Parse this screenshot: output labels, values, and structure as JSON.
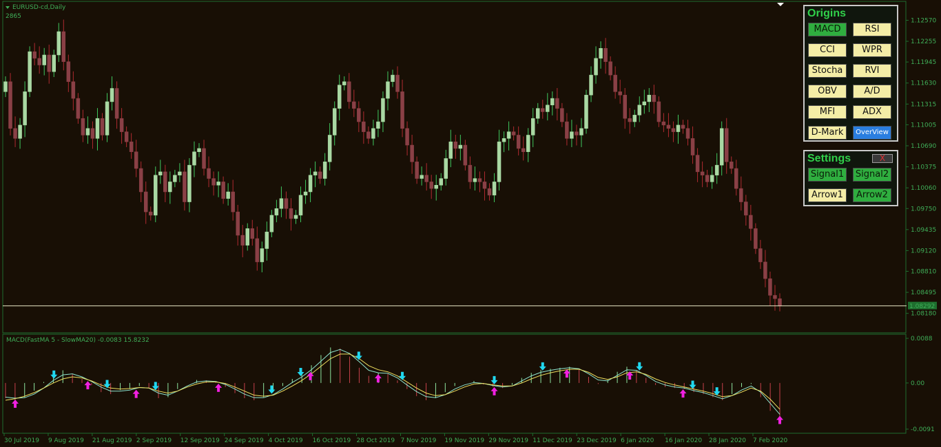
{
  "window": {
    "symbol_label": "EURUSD-cd,Daily",
    "sub_label": "2865",
    "menu_icon": "triangle-down-icon",
    "shift_marker_icon": "triangle-down-icon"
  },
  "colors": {
    "background": "#180f05",
    "grid_border": "#1e6e2e",
    "axis_text": "#3fae58",
    "bull_candle": "#a9d8a3",
    "bull_wick": "#3fc95f",
    "bear_candle": "#8a4046",
    "bear_wick": "#b02a30",
    "price_line": "#ecebc8",
    "macd_up_hist": "#8fe6a0",
    "macd_down_hist": "#c8414b",
    "signal_fast": "#8fe6d0",
    "signal_slow": "#f0e060",
    "arrow_down": "#20d8f0",
    "arrow_up": "#f020e0",
    "button_active": "#2fae3f",
    "button_inactive": "#f4eda6",
    "button_overview": "#2a7ee0"
  },
  "chart_data": [
    {
      "type": "candlestick",
      "symbol": "EURUSD-cd",
      "timeframe": "Daily",
      "ylim": [
        1.0795,
        1.1275
      ],
      "y_ticks": [
        "1.12570",
        "1.12255",
        "1.11945",
        "1.11630",
        "1.11315",
        "1.11005",
        "1.10690",
        "1.10375",
        "1.10060",
        "1.09750",
        "1.09435",
        "1.09120",
        "1.08810",
        "1.08495",
        "1.08180"
      ],
      "x_ticks": [
        "30 Jul 2019",
        "9 Aug 2019",
        "21 Aug 2019",
        "2 Sep 2019",
        "12 Sep 2019",
        "24 Sep 2019",
        "4 Oct 2019",
        "16 Oct 2019",
        "28 Oct 2019",
        "7 Nov 2019",
        "19 Nov 2019",
        "29 Nov 2019",
        "11 Dec 2019",
        "23 Dec 2019",
        "6 Jan 2020",
        "16 Jan 2020",
        "28 Jan 2020",
        "7 Feb 2020"
      ],
      "current_price": "1.08292",
      "close_values": [
        1.1165,
        1.1095,
        1.108,
        1.11,
        1.115,
        1.121,
        1.12,
        1.119,
        1.1205,
        1.118,
        1.1205,
        1.124,
        1.1195,
        1.1165,
        1.114,
        1.111,
        1.1085,
        1.1095,
        1.108,
        1.111,
        1.1085,
        1.1135,
        1.1155,
        1.111,
        1.109,
        1.1075,
        1.106,
        1.1035,
        1.1,
        1.097,
        1.0965,
        1.1025,
        1.103,
        1.1,
        1.1015,
        1.1025,
        1.103,
        1.0985,
        1.104,
        1.106,
        1.1065,
        1.1035,
        1.102,
        1.101,
        1.1015,
        1.099,
        1.1,
        1.097,
        1.0935,
        1.092,
        1.0945,
        1.093,
        1.0895,
        1.0915,
        1.094,
        1.0965,
        1.0975,
        1.099,
        1.0975,
        1.096,
        1.0965,
        1.0995,
        1.1,
        1.1025,
        1.103,
        1.102,
        1.1045,
        1.1085,
        1.1125,
        1.116,
        1.1165,
        1.1135,
        1.1125,
        1.1105,
        1.109,
        1.108,
        1.1095,
        1.1105,
        1.114,
        1.1165,
        1.1175,
        1.115,
        1.1095,
        1.107,
        1.1045,
        1.102,
        1.1025,
        1.1015,
        1.1005,
        1.101,
        1.102,
        1.105,
        1.1075,
        1.1065,
        1.107,
        1.104,
        1.1015,
        1.102,
        1.1015,
        1.1005,
        1.0995,
        1.1015,
        1.1075,
        1.108,
        1.109,
        1.1085,
        1.1065,
        1.106,
        1.1085,
        1.111,
        1.1125,
        1.112,
        1.113,
        1.114,
        1.1125,
        1.1105,
        1.108,
        1.109,
        1.1085,
        1.1095,
        1.1145,
        1.1175,
        1.12,
        1.1215,
        1.1195,
        1.1175,
        1.115,
        1.1145,
        1.111,
        1.1105,
        1.1115,
        1.113,
        1.1135,
        1.1145,
        1.1135,
        1.1105,
        1.11,
        1.1095,
        1.109,
        1.11,
        1.1095,
        1.108,
        1.1055,
        1.103,
        1.1025,
        1.1015,
        1.1025,
        1.104,
        1.1095,
        1.1045,
        1.1035,
        1.1005,
        1.0985,
        1.0965,
        1.0945,
        1.0915,
        1.0895,
        1.087,
        1.0845,
        1.084,
        1.0829
      ]
    },
    {
      "type": "bar+line",
      "title": "MACD(FastMA 5 - SlowMA20) -0.0083 15.8232",
      "ylim": [
        -0.0091,
        0.0088
      ],
      "y_ticks": [
        "0.0088",
        "0.00",
        "-0.0091"
      ],
      "series": [
        {
          "name": "",
          "values": [
            -0.003,
            -0.0034,
            -0.0028,
            -0.0015,
            0.0002,
            0.0018,
            0.0025,
            0.0018,
            0.0008,
            -0.0004,
            -0.0018,
            -0.0022,
            -0.0014,
            -0.0012,
            -0.0006,
            -0.001,
            -0.003,
            -0.0028,
            -0.0012,
            0.0,
            0.0006,
            0.0005,
            0.0002,
            -0.0008,
            -0.002,
            -0.003,
            -0.0034,
            -0.0028,
            -0.0018,
            -0.0006,
            0.0008,
            0.002,
            0.0035,
            0.0055,
            0.007,
            0.0068,
            0.0052,
            0.003,
            0.0014,
            0.002,
            0.0018,
            0.0005,
            -0.0012,
            -0.0026,
            -0.0034,
            -0.003,
            -0.0018,
            -0.0006,
            0.0,
            0.0004,
            -0.0003,
            -0.0008,
            -0.001,
            -0.0004,
            0.001,
            0.002,
            0.0026,
            0.0028,
            0.003,
            0.0032,
            0.0026,
            0.0012,
            -0.0002,
            0.0006,
            0.0022,
            0.0032,
            0.0024,
            0.001,
            -0.0004,
            -0.0008,
            -0.001,
            -0.0012,
            -0.0018,
            -0.0022,
            -0.0028,
            -0.0034,
            -0.0022,
            -0.0008,
            -0.0002,
            -0.0028,
            -0.0055,
            -0.0075
          ]
        },
        {
          "name": "",
          "values": [
            -0.0028,
            -0.003,
            -0.0029,
            -0.0022,
            -0.001,
            0.0005,
            0.0016,
            0.0018,
            0.0012,
            0.0003,
            -0.0008,
            -0.0016,
            -0.0016,
            -0.0014,
            -0.0009,
            -0.001,
            -0.002,
            -0.0024,
            -0.0016,
            -0.0006,
            0.0002,
            0.0004,
            0.0003,
            -0.0003,
            -0.0012,
            -0.0022,
            -0.0029,
            -0.0029,
            -0.0023,
            -0.0012,
            0.0001,
            0.0012,
            0.0026,
            0.0043,
            0.006,
            0.0066,
            0.0058,
            0.0042,
            0.0025,
            0.002,
            0.0019,
            0.001,
            -0.0004,
            -0.0017,
            -0.0027,
            -0.0029,
            -0.0023,
            -0.0012,
            -0.0004,
            0.0001,
            -0.0001,
            -0.0005,
            -0.0008,
            -0.0006,
            0.0004,
            0.0014,
            0.0021,
            0.0025,
            0.0028,
            0.003,
            0.0028,
            0.0018,
            0.0006,
            0.0004,
            0.0015,
            0.0026,
            0.0025,
            0.0015,
            0.0003,
            -0.0004,
            -0.0008,
            -0.001,
            -0.0015,
            -0.0019,
            -0.0025,
            -0.0031,
            -0.0025,
            -0.0014,
            -0.0006,
            -0.0018,
            -0.004,
            -0.0062
          ]
        },
        {
          "name": "",
          "values": [
            -0.0034,
            -0.0031,
            -0.0026,
            -0.0019,
            -0.001,
            0.0,
            0.0008,
            0.0012,
            0.001,
            0.0004,
            -0.0004,
            -0.001,
            -0.0012,
            -0.0011,
            -0.0009,
            -0.001,
            -0.0016,
            -0.002,
            -0.0016,
            -0.0008,
            -0.0002,
            0.0002,
            0.0002,
            -0.0001,
            -0.0008,
            -0.0016,
            -0.0024,
            -0.0026,
            -0.0024,
            -0.0016,
            -0.0006,
            0.0005,
            0.0018,
            0.0033,
            0.0048,
            0.0057,
            0.0057,
            0.0048,
            0.0034,
            0.0026,
            0.0022,
            0.0014,
            0.0002,
            -0.001,
            -0.002,
            -0.0025,
            -0.0023,
            -0.0016,
            -0.0008,
            -0.0002,
            -0.0001,
            -0.0004,
            -0.0006,
            -0.0006,
            0.0,
            0.0008,
            0.0015,
            0.002,
            0.0024,
            0.0027,
            0.0027,
            0.0021,
            0.0011,
            0.0007,
            0.0012,
            0.002,
            0.0022,
            0.0017,
            0.0008,
            0.0001,
            -0.0004,
            -0.0008,
            -0.0012,
            -0.0016,
            -0.0021,
            -0.0027,
            -0.0025,
            -0.0018,
            -0.001,
            -0.0016,
            -0.0032,
            -0.0052
          ]
        }
      ],
      "arrows_down_at": [
        10,
        21,
        31,
        55,
        61,
        73,
        82,
        101,
        111,
        131,
        142,
        147,
        168
      ],
      "arrows_up_at": [
        2,
        17,
        27,
        44,
        63,
        77,
        101,
        116,
        129,
        140,
        160
      ]
    }
  ],
  "origins_panel": {
    "title": "Origins",
    "buttons": [
      {
        "label": "MACD",
        "active": true
      },
      {
        "label": "RSI",
        "active": false
      },
      {
        "label": "CCI",
        "active": false
      },
      {
        "label": "WPR",
        "active": false
      },
      {
        "label": "Stocha",
        "active": false
      },
      {
        "label": "RVI",
        "active": false
      },
      {
        "label": "OBV",
        "active": false
      },
      {
        "label": "A/D",
        "active": false
      },
      {
        "label": "MFI",
        "active": false
      },
      {
        "label": "ADX",
        "active": false
      },
      {
        "label": "D-Mark",
        "active": false
      },
      {
        "label": "OverView",
        "active": "blue"
      }
    ]
  },
  "settings_panel": {
    "title": "Settings",
    "close_label": "X",
    "buttons": [
      {
        "label": "Signal1",
        "active": true
      },
      {
        "label": "Signal2",
        "active": true
      },
      {
        "label": "Arrow1",
        "active": false
      },
      {
        "label": "Arrow2",
        "active": true
      }
    ]
  }
}
